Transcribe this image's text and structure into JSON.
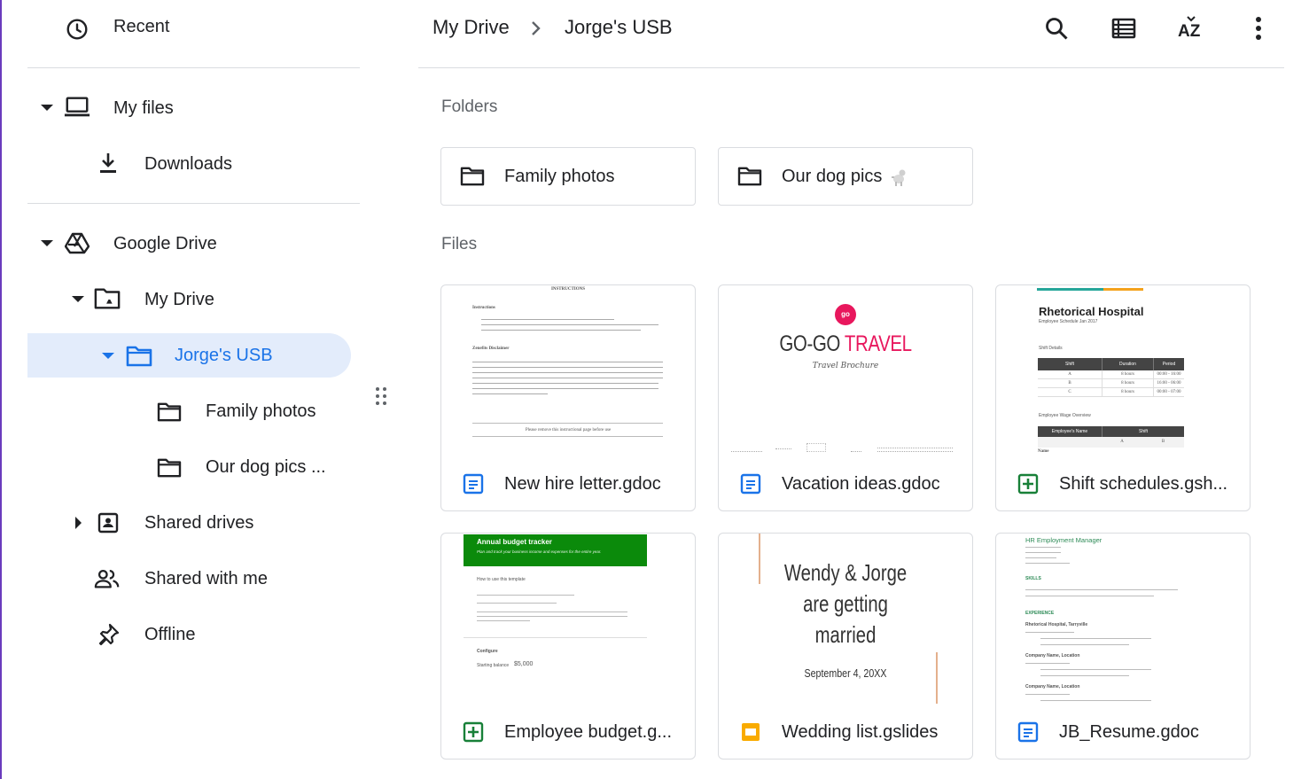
{
  "sidebar": {
    "recent": "Recent",
    "my_files": "My files",
    "downloads": "Downloads",
    "google_drive": "Google Drive",
    "my_drive": "My Drive",
    "jorges_usb": "Jorge's USB",
    "family_photos": "Family photos",
    "our_dog_pics": "Our dog pics ...",
    "shared_drives": "Shared drives",
    "shared_with_me": "Shared with me",
    "offline": "Offline"
  },
  "header": {
    "breadcrumb": [
      "My Drive",
      "Jorge's USB"
    ],
    "actions": [
      "search-icon",
      "list-view-icon",
      "sort-az-icon",
      "more-vert-icon"
    ]
  },
  "main": {
    "folders_title": "Folders",
    "files_title": "Files",
    "folders": [
      {
        "name": "Family photos"
      },
      {
        "name": "Our dog pics"
      }
    ],
    "files": [
      {
        "name": "New hire letter.gdoc",
        "type": "doc"
      },
      {
        "name": "Vacation ideas.gdoc",
        "type": "doc"
      },
      {
        "name": "Shift schedules.gsh...",
        "type": "sheet"
      },
      {
        "name": "Employee budget.g...",
        "type": "sheet"
      },
      {
        "name": "Wedding list.gslides",
        "type": "slides"
      },
      {
        "name": "JB_Resume.gdoc",
        "type": "doc"
      }
    ]
  },
  "thumbs": {
    "newhire": {
      "heading": "INSTRUCTIONS",
      "instructions": "Instructions",
      "disclaimer": "Zenefits Disclaimer",
      "remove": "Please remove this instructional page before use"
    },
    "vacation": {
      "title_a": "GO-GO",
      "title_b": "TRAVEL",
      "subtitle": "Travel Brochure",
      "logo": "go"
    },
    "shift": {
      "title": "Rhetorical Hospital",
      "subtitle": "Employee Schedule Jan 2017",
      "section": "Shift Details",
      "cols": [
        "Shift",
        "Duration",
        "Period"
      ],
      "rows": [
        [
          "A",
          "8 hours",
          "00:00 - 16:00"
        ],
        [
          "B",
          "8 hours",
          "16:00 - 06:00"
        ],
        [
          "C",
          "8 hours",
          "00:00 - 07:00"
        ]
      ],
      "section2": "Employee Wage Overview",
      "cols2": [
        "Employee's Name",
        "Shift"
      ],
      "ab": [
        "A",
        "B"
      ],
      "name_label": "Name"
    },
    "budget": {
      "title": "Annual budget tracker",
      "subtitle": "Plan and track your business income and expenses for the entire year.",
      "how": "How to use this template",
      "configure": "Configure",
      "start_label": "Starting balance",
      "start_value": "$5,000"
    },
    "wedding": {
      "line1": "Wendy & Jorge",
      "line2": "are getting",
      "line3": "married",
      "date": "September 4, 20XX"
    },
    "resume": {
      "role": "HR Employment Manager",
      "skills": "SKILLS",
      "experience": "EXPERIENCE",
      "job1": "Rhetorical Hospital, Tarryville",
      "job2": "Company Name, Location",
      "job3": "Company Name, Location"
    }
  },
  "colors": {
    "accent_blue": "#1a73e8",
    "selected_bg": "#e3ecfb",
    "sheet_green": "#188038",
    "slides_yellow": "#f9ab00",
    "travel_pink": "#e8175d"
  }
}
